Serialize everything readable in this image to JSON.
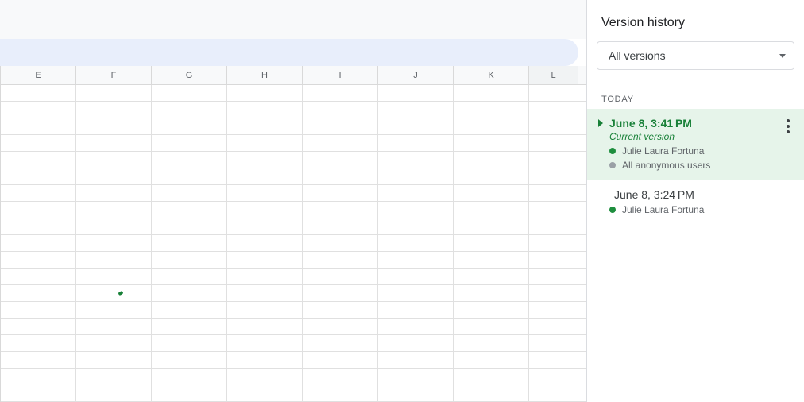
{
  "spreadsheet": {
    "columns": [
      "E",
      "F",
      "G",
      "H",
      "I",
      "J",
      "K",
      "L"
    ],
    "row_count": 19,
    "green_mark": {
      "row_index": 12,
      "col_index": 1
    }
  },
  "panel": {
    "title": "Version history",
    "filter": {
      "label": "All versions"
    },
    "group_label": "TODAY",
    "versions": [
      {
        "timestamp": "June 8, 3:41 PM",
        "is_current": true,
        "current_label": "Current version",
        "selected": true,
        "contributors": [
          {
            "name": "Julie Laura Fortuna",
            "color": "#1e8e3e"
          },
          {
            "name": "All anonymous users",
            "color": "#9aa0a6"
          }
        ]
      },
      {
        "timestamp": "June 8, 3:24 PM",
        "is_current": false,
        "selected": false,
        "contributors": [
          {
            "name": "Julie Laura Fortuna",
            "color": "#1e8e3e"
          }
        ]
      }
    ]
  }
}
